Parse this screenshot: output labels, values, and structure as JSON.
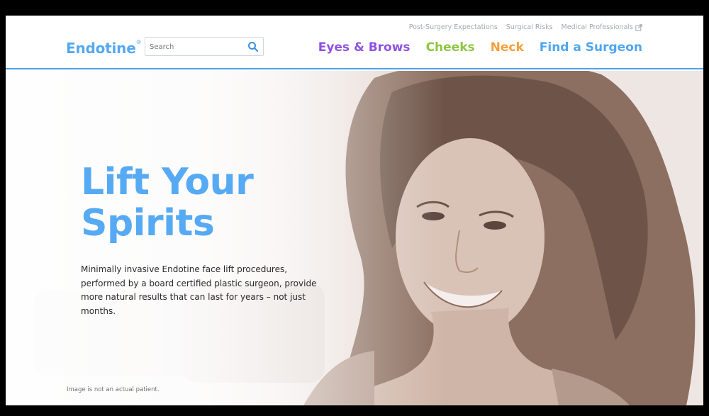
{
  "brand": {
    "name": "Endotine",
    "mark": "®"
  },
  "search": {
    "placeholder": "Search"
  },
  "utility_nav": [
    {
      "label": "Post-Surgery Expectations"
    },
    {
      "label": "Surgical Risks"
    },
    {
      "label": "Medical Professionals",
      "icon": "external-link-icon"
    }
  ],
  "main_nav": [
    {
      "label": "Eyes & Brows",
      "color": "#8f52e0"
    },
    {
      "label": "Cheeks",
      "color": "#8dc63f"
    },
    {
      "label": "Neck",
      "color": "#f5a03a"
    },
    {
      "label": "Find a Surgeon",
      "color": "#4ea6f0"
    }
  ],
  "hero": {
    "headline_line1": "Lift Your",
    "headline_line2": "Spirits",
    "body": "Minimally invasive Endotine face lift procedures, performed by a board certified plastic surgeon, provide more natural results that can last for years – not just months.",
    "disclaimer": "Image is not an actual patient."
  },
  "colors": {
    "accent": "#4da3ea",
    "headline": "#56aaf3"
  }
}
